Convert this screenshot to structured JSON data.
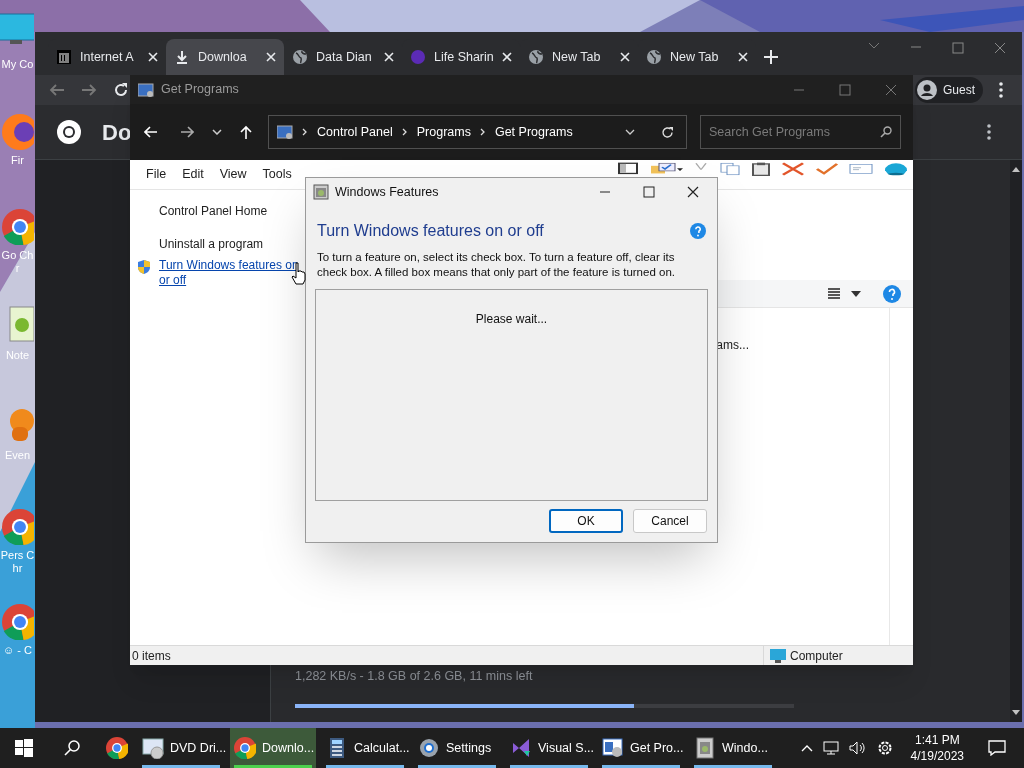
{
  "desktop_icons": [
    {
      "label": "My Co",
      "kind": "monitor"
    },
    {
      "label": "Fir",
      "kind": "firefox"
    },
    {
      "label": "Go Chr",
      "kind": "chrome"
    },
    {
      "label": "Note",
      "kind": "notepad"
    },
    {
      "label": "Even",
      "kind": "orange"
    },
    {
      "label": "Pers Chr",
      "kind": "chrome"
    },
    {
      "label": "☺ - C",
      "kind": "chrome"
    }
  ],
  "browser": {
    "tabs": [
      {
        "title": "Internet A",
        "kind": "archive",
        "selected": false
      },
      {
        "title": "Downloa",
        "kind": "download",
        "selected": true
      },
      {
        "title": "Data Dian",
        "kind": "globe",
        "selected": false
      },
      {
        "title": "Life Sharin",
        "kind": "dot",
        "selected": false
      },
      {
        "title": "New Tab",
        "kind": "globe",
        "selected": false
      },
      {
        "title": "New Tab",
        "kind": "globe",
        "selected": false
      }
    ],
    "profile": "Guest",
    "page_heading": "Do",
    "download": {
      "status": "1,282 KB/s - 1.8 GB of 2.6 GB, 11 mins left",
      "level": 0.68
    }
  },
  "explorer": {
    "title": "Get Programs",
    "breadcrumb": [
      "Control Panel",
      "Programs",
      "Get Programs"
    ],
    "search": {
      "placeholder": "Search Get Programs"
    },
    "menu": [
      "File",
      "Edit",
      "View",
      "Tools"
    ],
    "sidebar": [
      {
        "label": "Control Panel Home",
        "kind": "text"
      },
      {
        "label": "Uninstall a program",
        "kind": "text"
      },
      {
        "label": "Turn Windows features on or off",
        "kind": "link"
      }
    ],
    "content_text": "ams...",
    "status_bar": {
      "items": "0 items",
      "location": "Computer"
    }
  },
  "dialog": {
    "title": "Windows Features",
    "heading": "Turn Windows features on or off",
    "description": "To turn a feature on, select its check box. To turn a feature off, clear its check box. A filled box means that only part of the feature is turned on.",
    "list_status": "Please wait...",
    "buttons": [
      {
        "label": "OK",
        "default": true
      },
      {
        "label": "Cancel",
        "default": false
      }
    ]
  },
  "taskbar": {
    "items": [
      {
        "kind": "chrome",
        "selected": false,
        "running": false
      },
      {
        "label": "DVD Dri...",
        "kind": "dvd",
        "selected": false,
        "running": true
      },
      {
        "label": "Downlo...",
        "kind": "chrome",
        "selected": true,
        "running": true
      },
      {
        "label": "Calculat...",
        "kind": "calculator",
        "selected": false,
        "running": true
      },
      {
        "label": "Settings",
        "kind": "gear",
        "selected": false,
        "running": true
      },
      {
        "label": "Visual S...",
        "kind": "vs",
        "selected": false,
        "running": true
      },
      {
        "label": "Get Pro...",
        "kind": "programs",
        "selected": false,
        "running": true
      },
      {
        "label": "Windo...",
        "kind": "features",
        "selected": false,
        "running": true
      }
    ],
    "time": "1:41 PM",
    "date": "4/19/2023"
  }
}
